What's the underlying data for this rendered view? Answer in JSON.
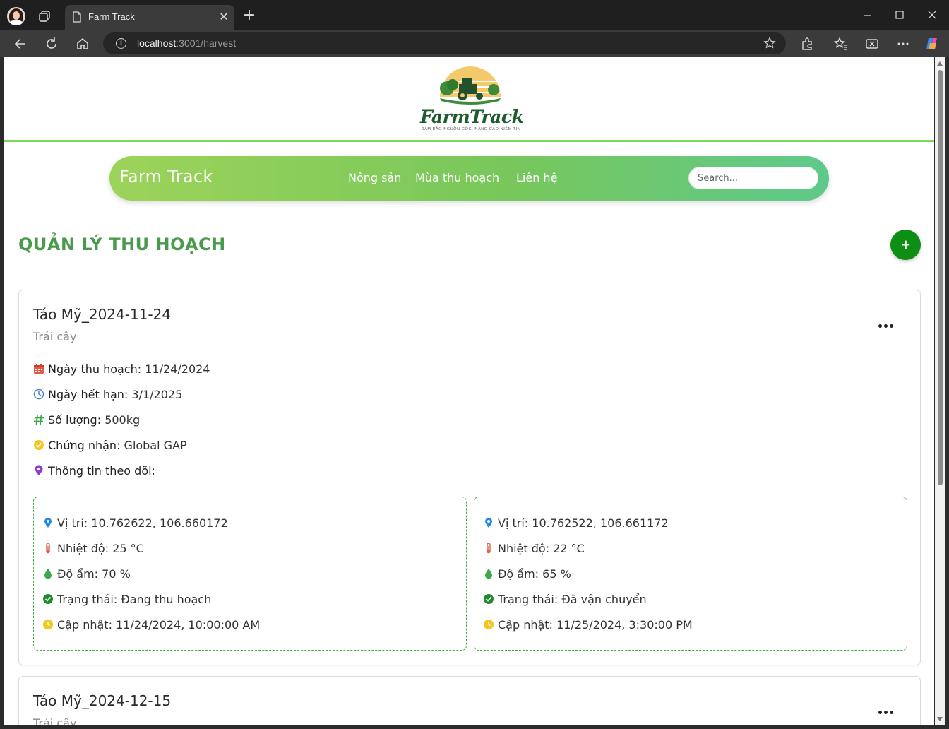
{
  "browser": {
    "tab_title": "Farm Track",
    "url_host": "localhost",
    "url_rest": ":3001/harvest"
  },
  "header": {
    "logo_text": "FarmTrack",
    "logo_tagline": "ĐẢM BẢO NGUỒN GỐC, NÂNG CAO NIỀM TIN"
  },
  "nav": {
    "brand": "Farm Track",
    "links": [
      "Nông sản",
      "Mùa thu hoạch",
      "Liên hệ"
    ],
    "search_placeholder": "Search..."
  },
  "page": {
    "title": "QUẢN LÝ THU HOẠCH",
    "add_label": "+"
  },
  "labels": {
    "harvest_date": "Ngày thu hoạch:",
    "expiry_date": "Ngày hết hạn:",
    "quantity": "Số lượng:",
    "certification": "Chứng nhận:",
    "tracking": "Thông tin theo dõi:",
    "location": "Vị trí:",
    "temperature": "Nhiệt độ:",
    "humidity": "Độ ẩm:",
    "status": "Trạng thái:",
    "updated": "Cập nhật:"
  },
  "harvests": [
    {
      "name": "Táo Mỹ_2024-11-24",
      "category": "Trái cây",
      "harvest_date": "11/24/2024",
      "expiry_date": "3/1/2025",
      "quantity": "500kg",
      "certification": "Global GAP",
      "tracking": [
        {
          "location": "10.762622, 106.660172",
          "temperature": "25 °C",
          "humidity": "70 %",
          "status": "Đang thu hoạch",
          "updated": "11/24/2024, 10:00:00 AM"
        },
        {
          "location": "10.762522, 106.661172",
          "temperature": "22 °C",
          "humidity": "65 %",
          "status": "Đã vận chuyển",
          "updated": "11/25/2024, 3:30:00 PM"
        }
      ]
    },
    {
      "name": "Táo Mỹ_2024-12-15",
      "category": "Trái cây"
    }
  ],
  "colors": {
    "nav_gradient_start": "#9dd35a",
    "nav_gradient_end": "#5ec98c",
    "title_green": "#4a9a4e",
    "add_button": "#0d8f13",
    "tracking_border": "#3fae3f"
  }
}
